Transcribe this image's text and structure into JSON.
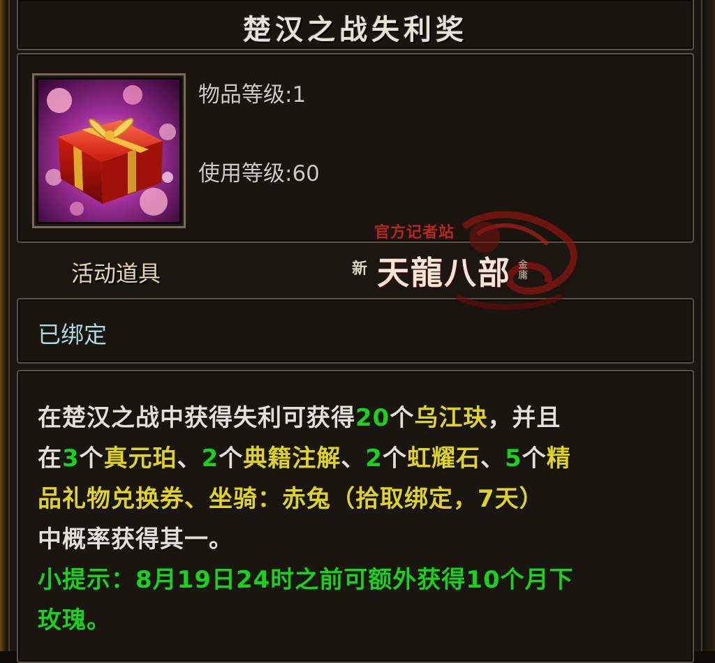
{
  "tooltip": {
    "title": "楚汉之战失利奖",
    "item_level_label": "物品等级",
    "item_level_value": "1",
    "use_level_label": "使用等级",
    "use_level_value": "60",
    "item_type": "活动道具",
    "bind_status": "已绑定",
    "icon": "gift-box-icon",
    "description": {
      "line1": [
        {
          "t": "在楚汉之战中获得失利可获得",
          "c": "white"
        },
        {
          "t": "20",
          "c": "green"
        },
        {
          "t": "个",
          "c": "white"
        },
        {
          "t": "乌江玦",
          "c": "yellow"
        },
        {
          "t": "，并且",
          "c": "white"
        }
      ],
      "line2": [
        {
          "t": "在",
          "c": "white"
        },
        {
          "t": "3",
          "c": "green"
        },
        {
          "t": "个",
          "c": "white"
        },
        {
          "t": "真元珀",
          "c": "yellow"
        },
        {
          "t": "、",
          "c": "white"
        },
        {
          "t": "2",
          "c": "green"
        },
        {
          "t": "个",
          "c": "white"
        },
        {
          "t": "典籍注解",
          "c": "yellow"
        },
        {
          "t": "、",
          "c": "white"
        },
        {
          "t": "2",
          "c": "green"
        },
        {
          "t": "个",
          "c": "white"
        },
        {
          "t": "虹耀石",
          "c": "yellow"
        },
        {
          "t": "、",
          "c": "white"
        },
        {
          "t": "5",
          "c": "green"
        },
        {
          "t": "个",
          "c": "white"
        },
        {
          "t": "精",
          "c": "yellow"
        }
      ],
      "line3": [
        {
          "t": "品礼物兑换券、坐骑：赤兔（拾取绑定，7天）",
          "c": "yellow"
        }
      ],
      "line4": [
        {
          "t": "中概率获得其一。",
          "c": "white"
        }
      ],
      "tip_line1": "小提示：8月19日24时之前可额外获得10个月下",
      "tip_line2": "玫瑰。"
    }
  },
  "watermark": {
    "top_text": "官方记者站",
    "prefix": "新",
    "main_text": "天龍八部",
    "suffix": "金庸"
  },
  "colors": {
    "white": "#e3e0d8",
    "green": "#16d416",
    "yellow": "#e0d51c",
    "bound": "#a9dbe0",
    "type": "#e6d7b0"
  }
}
